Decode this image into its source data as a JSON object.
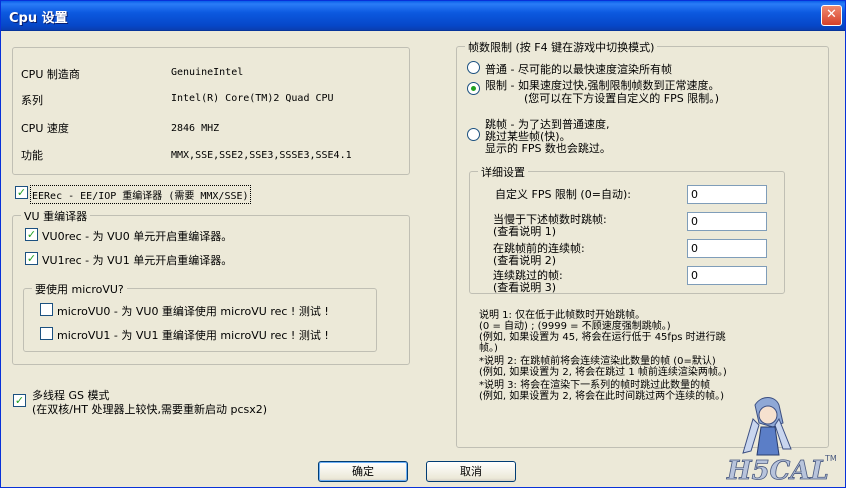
{
  "window": {
    "title": "Cpu 设置",
    "close_label": "✕"
  },
  "cpu_info": {
    "rows": [
      {
        "label": "CPU 制造商",
        "value": "GenuineIntel"
      },
      {
        "label": "系列",
        "value": "Intel(R) Core(TM)2 Quad CPU"
      },
      {
        "label": "CPU 速度",
        "value": "2846 MHZ"
      },
      {
        "label": "功能",
        "value": "MMX,SSE,SSE2,SSE3,SSSE3,SSE4.1"
      }
    ]
  },
  "eerec": {
    "label": "EERec -  EE/IOP 重编译器 (需要 MMX/SSE)",
    "checked": true
  },
  "vu": {
    "legend": "VU  重编译器",
    "vu0": {
      "label": "VU0rec - 为 VU0 单元开启重编译器。",
      "checked": true
    },
    "vu1": {
      "label": "VU1rec - 为 VU1 单元开启重编译器。",
      "checked": true
    },
    "microvu": {
      "legend": "要使用 microVU?",
      "mvu0": {
        "label": "microVU0 - 为 VU0 重编译使用 microVU rec ! 测试 !",
        "checked": false
      },
      "mvu1": {
        "label": "microVU1 - 为 VU1 重编译使用 microVU rec ! 测试 !",
        "checked": false
      }
    }
  },
  "mtgs": {
    "label": "多线程 GS 模式",
    "sublabel": "(在双核/HT 处理器上较快,需要重新启动 pcsx2)",
    "checked": true
  },
  "frame_limit": {
    "legend": "帧数限制 (按 F4 键在游戏中切换模式)",
    "normal": {
      "label": "普通 - 尽可能的以最快速度渲染所有帧",
      "selected": false
    },
    "limit": {
      "label": "限制 - 如果速度过快,强制限制帧数到正常速度。",
      "sublabel": "(您可以在下方设置自定义的 FPS 限制。)",
      "selected": true
    },
    "skip": {
      "line1": "跳帧 - 为了达到普通速度,",
      "line2": "跳过某些帧(快)。",
      "line3": "显示的 FPS 数也会跳过。",
      "selected": false
    }
  },
  "details": {
    "legend": "详细设置",
    "custom_fps": {
      "label": "自定义 FPS 限制 (0=自动):",
      "value": "0"
    },
    "skip_when_slow": {
      "label1": "当慢于下述帧数时跳帧:",
      "label2": "(查看说明 1)",
      "value": "0"
    },
    "consecutive_before": {
      "label1": "在跳帧前的连续帧:",
      "label2": "(查看说明 2)",
      "value": "0"
    },
    "consecutive_skip": {
      "label1": "连续跳过的帧:",
      "label2": "(查看说明 3)",
      "value": "0"
    }
  },
  "notes": [
    "说明 1: 仅在低于此帧数时开始跳帧。",
    " (0 = 自动) ; (9999 = 不顾速度强制跳帧。)",
    " (例如, 如果设置为 45, 将会在运行低于 45fps 时进行跳",
    "帧。)",
    "*说明 2: 在跳帧前将会连续渲染此数量的帧 (0=默认)",
    " (例如, 如果设置为 2, 将会在跳过 1 帧前连续渲染两帧。)",
    "*说明 3: 将会在渲染下一系列的帧时跳过此数量的帧",
    " (例如, 如果设置为 2, 将会在此时间跳过两个连续的帧。)"
  ],
  "buttons": {
    "ok": "确定",
    "cancel": "取消"
  },
  "watermark": {
    "text": "H5CAL",
    "tm": "TM"
  }
}
